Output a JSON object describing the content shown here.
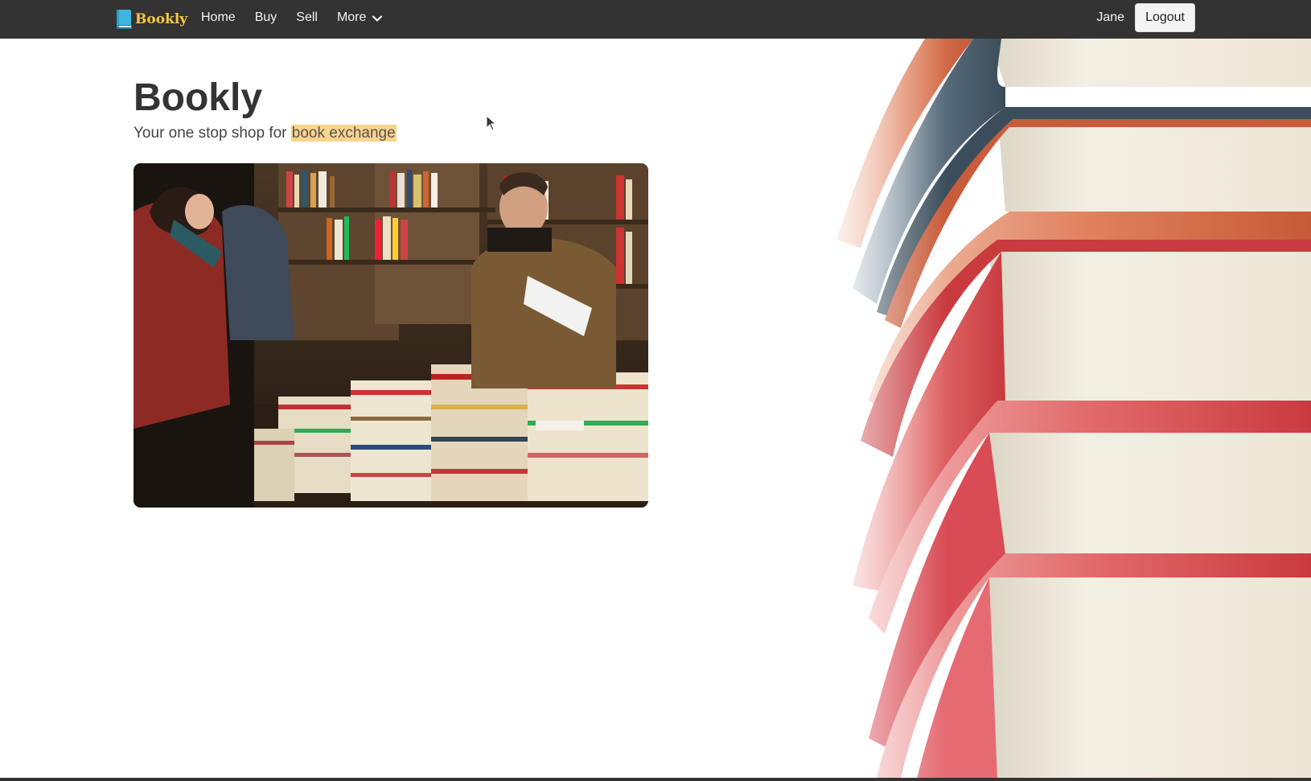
{
  "navbar": {
    "brand": "Bookly",
    "links": [
      {
        "label": "Home"
      },
      {
        "label": "Buy"
      },
      {
        "label": "Sell"
      },
      {
        "label": "More"
      }
    ],
    "user": "Jane",
    "logout_label": "Logout"
  },
  "hero": {
    "title": "Bookly",
    "subtitle_prefix": "Your one stop shop for ",
    "subtitle_highlight": "book exchange"
  },
  "colors": {
    "navbar_bg": "#333333",
    "brand": "#f5c842",
    "brand_icon": "#3fb6e0",
    "highlight": "#fbd38a"
  }
}
